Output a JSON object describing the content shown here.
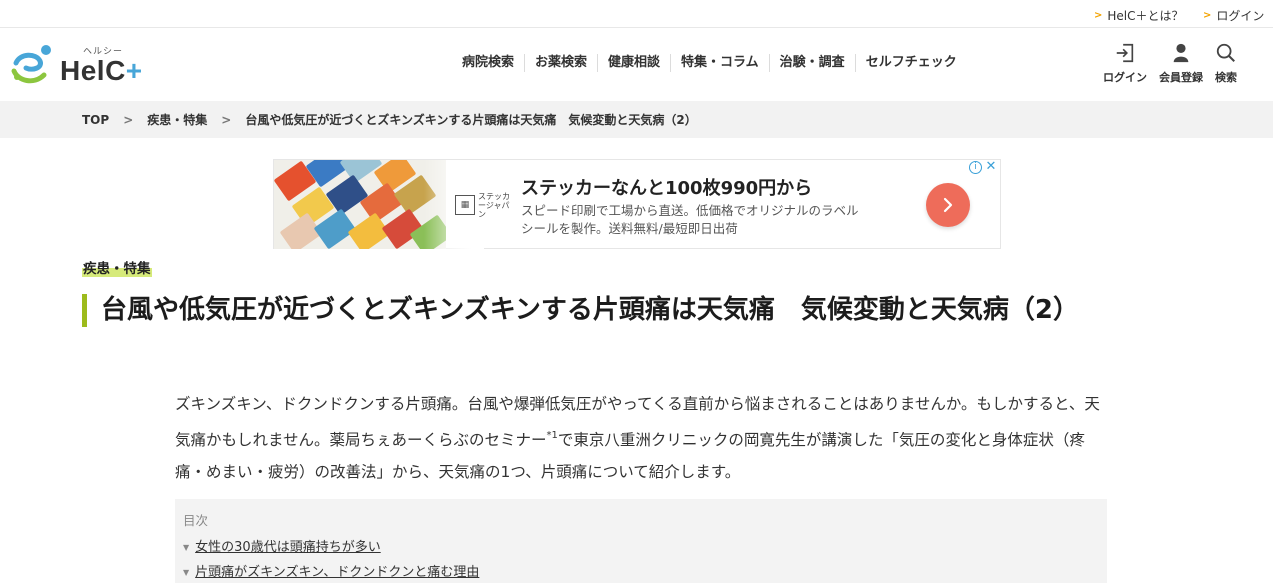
{
  "util_bar": {
    "about_label": "HelC＋とは？",
    "login_label": "ログイン"
  },
  "header": {
    "logo_kana": "ヘルシー",
    "logo_text": "HelC",
    "logo_plus": "+",
    "nav": [
      "病院検索",
      "お薬検索",
      "健康相談",
      "特集・コラム",
      "治験・調査",
      "セルフチェック"
    ],
    "icons": [
      {
        "label": "ログイン",
        "icon": "login-icon"
      },
      {
        "label": "会員登録",
        "icon": "person-icon"
      },
      {
        "label": "検索",
        "icon": "search-icon"
      }
    ]
  },
  "breadcrumb": {
    "items": [
      "TOP",
      "疾患・特集",
      "台風や低気圧が近づくとズキンズキンする片頭痛は天気痛　気候変動と天気病（2）"
    ]
  },
  "ad": {
    "brand": "ステッカージャパン",
    "title": "ステッカーなんと100枚990円から",
    "desc_line1": "スピード印刷で工場から直送。低価格でオリジナルのラベル",
    "desc_line2": "シールを製作。送料無料/最短即日出荷",
    "cta_color": "#ee6c5a"
  },
  "article": {
    "category": "疾患・特集",
    "title": "台風や低気圧が近づくとズキンズキンする片頭痛は天気痛　気候変動と天気病（2）",
    "lead_part1": "ズキンズキン、ドクンドクンする片頭痛。台風や爆弾低気圧がやってくる直前から悩まされることはありませんか。もしかすると、天気痛かもしれません。薬局ちぇあーくらぶのセミナー",
    "lead_sup": "*1",
    "lead_part2": "で東京八重洲クリニックの岡寛先生が講演した「気圧の変化と身体症状（疼痛・めまい・疲労）の改善法」から、天気痛の1つ、片頭痛について紹介します。",
    "accent_color": "#9dbb1c"
  },
  "toc": {
    "title": "目次",
    "items": [
      "女性の30歳代は頭痛持ちが多い",
      "片頭痛がズキンズキン、ドクンドクンと痛む理由"
    ]
  }
}
